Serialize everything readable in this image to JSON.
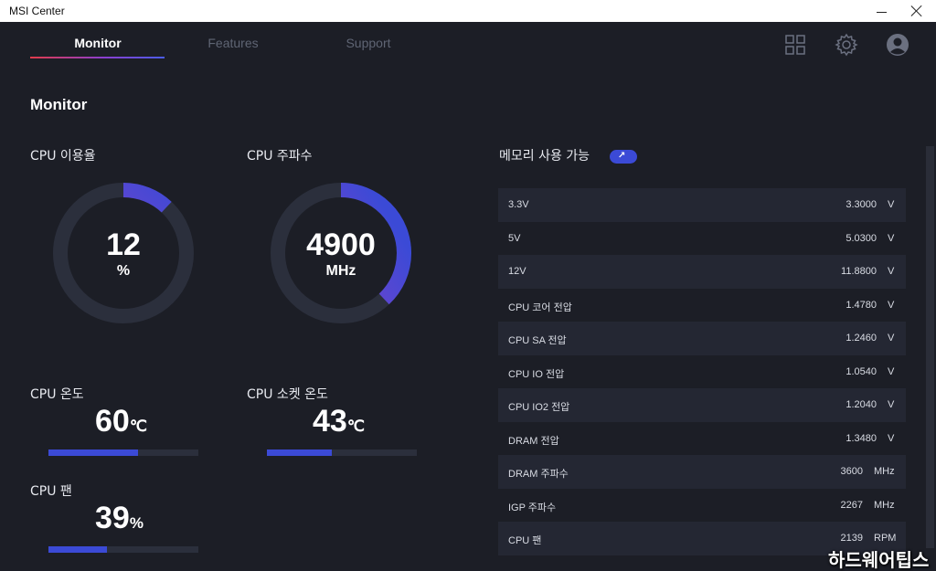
{
  "window": {
    "title": "MSI Center"
  },
  "nav": {
    "tabs": [
      {
        "label": "Monitor"
      },
      {
        "label": "Features"
      },
      {
        "label": "Support"
      }
    ]
  },
  "section": {
    "title": "Monitor"
  },
  "cpu_usage": {
    "label": "CPU 이용율",
    "value": "12",
    "unit": "%",
    "fraction": 0.12
  },
  "cpu_freq": {
    "label": "CPU 주파수",
    "value": "4900",
    "unit": "MHz",
    "fraction": 0.38
  },
  "cpu_temp": {
    "label": "CPU 온도",
    "value": "60",
    "unit": "℃",
    "fraction": 0.6
  },
  "socket_temp": {
    "label": "CPU 소켓 온도",
    "value": "43",
    "unit": "℃",
    "fraction": 0.43
  },
  "cpu_fan": {
    "label": "CPU 팬",
    "value": "39",
    "unit": "%",
    "fraction": 0.39
  },
  "memory": {
    "title": "메모리 사용 가능",
    "toggle_glyph": "↗",
    "rows": [
      {
        "name": "3.3V",
        "value": "3.3000",
        "unit": "V"
      },
      {
        "name": "5V",
        "value": "5.0300",
        "unit": "V"
      },
      {
        "name": "12V",
        "value": "11.8800",
        "unit": "V"
      },
      {
        "name": "CPU 코어 전압",
        "value": "1.4780",
        "unit": "V"
      },
      {
        "name": "CPU SA 전압",
        "value": "1.2460",
        "unit": "V"
      },
      {
        "name": "CPU IO 전압",
        "value": "1.0540",
        "unit": "V"
      },
      {
        "name": "CPU IO2 전압",
        "value": "1.2040",
        "unit": "V"
      },
      {
        "name": "DRAM 전압",
        "value": "1.3480",
        "unit": "V"
      },
      {
        "name": "DRAM 주파수",
        "value": "3600",
        "unit": "MHz"
      },
      {
        "name": "IGP 주파수",
        "value": "2267",
        "unit": "MHz"
      },
      {
        "name": "CPU 팬",
        "value": "2139",
        "unit": "RPM"
      }
    ]
  },
  "watermark": "하드웨어팁스",
  "colors": {
    "accent": "#3b4ad6",
    "gradient_start": "#9b3fc6",
    "background": "#1c1e26"
  }
}
